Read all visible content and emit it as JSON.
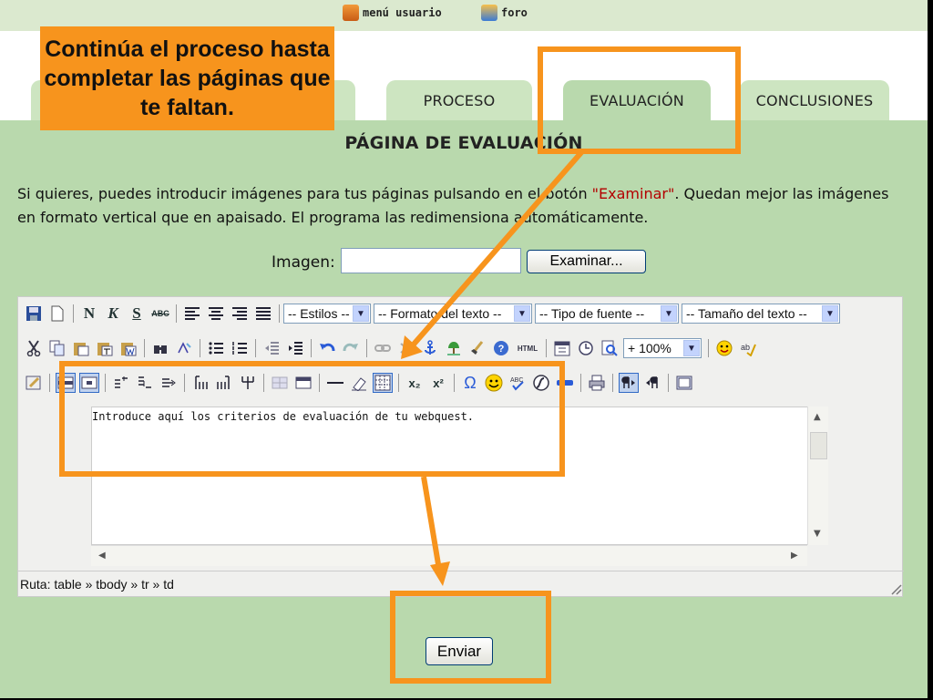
{
  "topnav": {
    "menu_label": "menú usuario",
    "forum_label": "foro"
  },
  "tabs": [
    {
      "label": "PROCESO"
    },
    {
      "label": "EVALUACIÓN",
      "active": true
    },
    {
      "label": "CONCLUSIONES"
    }
  ],
  "callout_text": "Continúa el proceso hasta completar las páginas que te faltan.",
  "page_title": "PÁGINA DE EVALUACIÓN",
  "intro": {
    "before": "Si quieres, puedes introducir imágenes para tus páginas pulsando en el botón ",
    "highlight": "\"Examinar\"",
    "after": ". Quedan mejor las imágenes en formato vertical que en apaisado. El programa las redimensiona automáticamente."
  },
  "image_field": {
    "label": "Imagen:",
    "value": "",
    "browse_label": "Examinar..."
  },
  "editor": {
    "dropdowns": {
      "styles": "-- Estilos --",
      "format": "-- Formato del texto --",
      "font": "-- Tipo de fuente --",
      "size": "-- Tamaño del texto --",
      "zoom": "+ 100%"
    },
    "toolbar_text": {
      "bold": "N",
      "italic": "K",
      "strike": "S",
      "spell": "ABC",
      "html": "HTML",
      "subscript": "x₂",
      "superscript": "x²",
      "omega": "Ω"
    },
    "content": "Introduce aquí los criterios de evaluación de tu webquest.",
    "path": "Ruta: table » tbody » tr » td"
  },
  "submit_label": "Enviar",
  "colors": {
    "accent_orange": "#f7941d",
    "page_green": "#b9d9ad",
    "tab_green": "#cde5c1",
    "highlight_red": "#b40000"
  }
}
